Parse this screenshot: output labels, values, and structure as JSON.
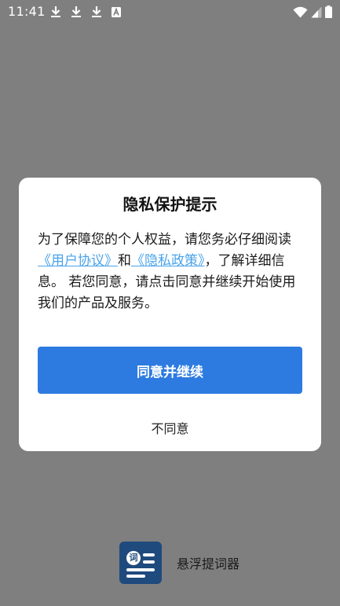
{
  "status_bar": {
    "time": "11:41",
    "left_icons": [
      "download-icon",
      "download-icon",
      "download-icon",
      "a-box-icon"
    ],
    "right_icons": [
      "wifi-icon",
      "signal-icon",
      "battery-icon"
    ]
  },
  "dialog": {
    "title": "隐私保护提示",
    "body_before_link1": "为了保障您的个人权益，请您务必仔细阅读",
    "link_user_agreement": "《用户协议》",
    "body_and": "和",
    "link_privacy_policy": "《隐私政策》",
    "body_after": "，了解详细信息。 若您同意，请点击同意并继续开始使用我们的产品及服务。",
    "agree_label": "同意并继续",
    "disagree_label": "不同意"
  },
  "brand": {
    "logo_icon": "teleprompter-logo-icon",
    "logo_char": "词",
    "app_name": "悬浮提词器"
  },
  "colors": {
    "overlay": "#7f7f7f",
    "accent": "#2d7be0",
    "link": "#4aa3ea",
    "logo_background": "#1f4a7e"
  }
}
